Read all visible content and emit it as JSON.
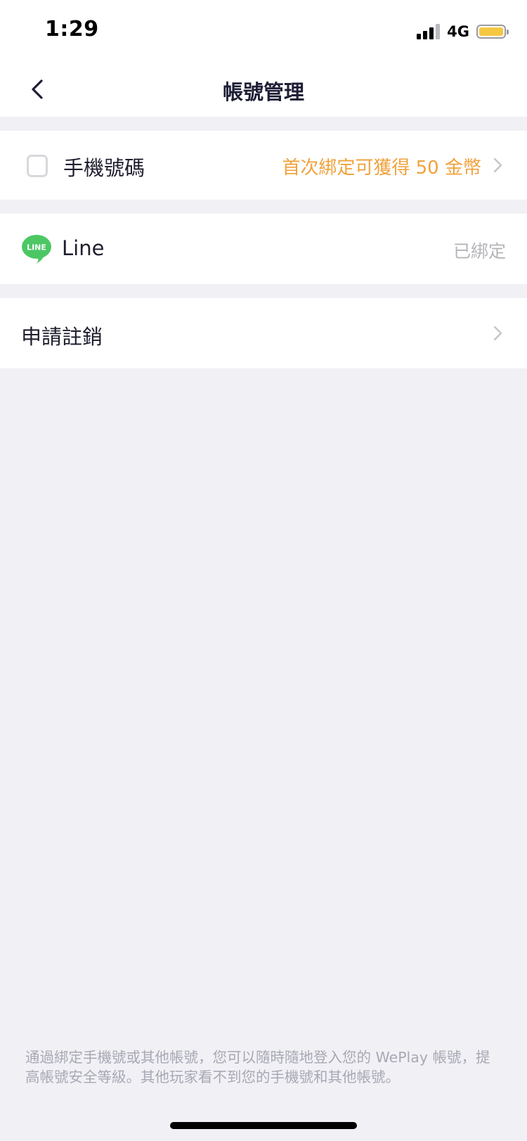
{
  "status_bar": {
    "time": "1:29",
    "network": "4G",
    "battery_color": "#f5c842"
  },
  "nav": {
    "title": "帳號管理",
    "back_icon": "chevron-left-icon"
  },
  "accounts": {
    "phone": {
      "icon": "phone-icon",
      "label": "手機號碼",
      "reward": "首次綁定可獲得 50 金幣"
    },
    "line": {
      "icon": "line-logo-icon",
      "logo_text": "LINE",
      "label": "Line",
      "status": "已綁定",
      "brand_color": "#4cc764"
    },
    "deactivate": {
      "label": "申請註銷"
    }
  },
  "footer": {
    "note": "通過綁定手機號或其他帳號，您可以隨時隨地登入您的 WePlay 帳號，提高帳號安全等級。其他玩家看不到您的手機號和其他帳號。"
  },
  "colors": {
    "background": "#f1f1f5",
    "accent_orange": "#f0a23c",
    "muted_text": "#b4b4ba"
  }
}
